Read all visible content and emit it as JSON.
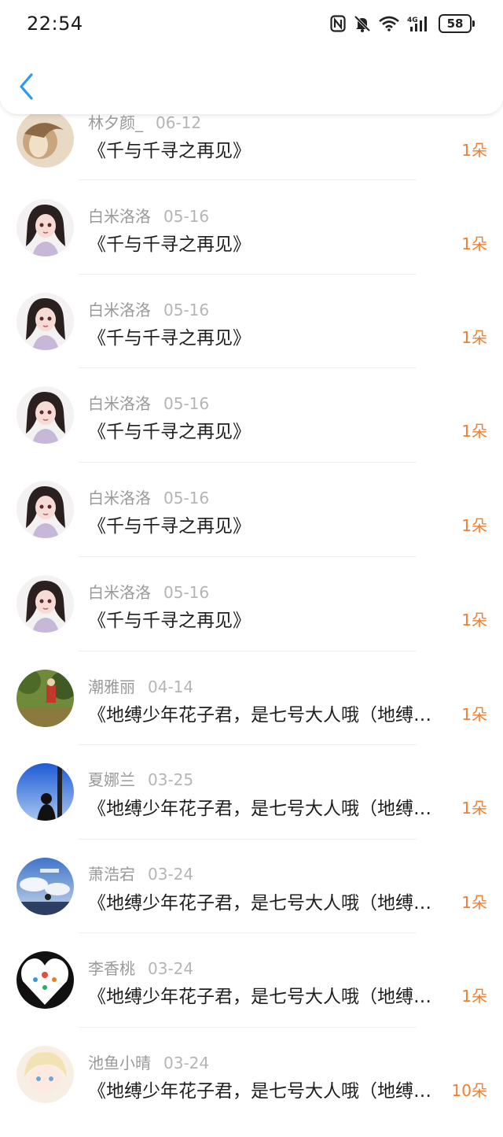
{
  "status_bar": {
    "time": "22:54",
    "battery": "58"
  },
  "colors": {
    "accent_back": "#2a9be8",
    "amount": "#f07f2e"
  },
  "items": [
    {
      "name": "林夕颜_",
      "date": "06-12",
      "title": "《千与千寻之再见》",
      "amount": "1朵",
      "avatar_icon": "portrait-sepia-avatar"
    },
    {
      "name": "白米洛洛",
      "date": "05-16",
      "title": "《千与千寻之再见》",
      "amount": "1朵",
      "avatar_icon": "anime-girl-avatar"
    },
    {
      "name": "白米洛洛",
      "date": "05-16",
      "title": "《千与千寻之再见》",
      "amount": "1朵",
      "avatar_icon": "anime-girl-avatar"
    },
    {
      "name": "白米洛洛",
      "date": "05-16",
      "title": "《千与千寻之再见》",
      "amount": "1朵",
      "avatar_icon": "anime-girl-avatar"
    },
    {
      "name": "白米洛洛",
      "date": "05-16",
      "title": "《千与千寻之再见》",
      "amount": "1朵",
      "avatar_icon": "anime-girl-avatar"
    },
    {
      "name": "白米洛洛",
      "date": "05-16",
      "title": "《千与千寻之再见》",
      "amount": "1朵",
      "avatar_icon": "anime-girl-avatar"
    },
    {
      "name": "潮雅丽",
      "date": "04-14",
      "title": "《地缚少年花子君，是七号大人哦（地缚…",
      "amount": "1朵",
      "avatar_icon": "forest-photo-avatar"
    },
    {
      "name": "夏娜兰",
      "date": "03-25",
      "title": "《地缚少年花子君，是七号大人哦（地缚…",
      "amount": "1朵",
      "avatar_icon": "sky-silhouette-avatar"
    },
    {
      "name": "萧浩宕",
      "date": "03-24",
      "title": "《地缚少年花子君，是七号大人哦（地缚…",
      "amount": "1朵",
      "avatar_icon": "cloud-sky-avatar"
    },
    {
      "name": "李香桃",
      "date": "03-24",
      "title": "《地缚少年花子君，是七号大人哦（地缚…",
      "amount": "1朵",
      "avatar_icon": "heart-diagram-avatar"
    },
    {
      "name": "池鱼小晴",
      "date": "03-24",
      "title": "《地缚少年花子君，是七号大人哦（地缚…",
      "amount": "10朵",
      "avatar_icon": "cartoon-girl-avatar"
    }
  ]
}
